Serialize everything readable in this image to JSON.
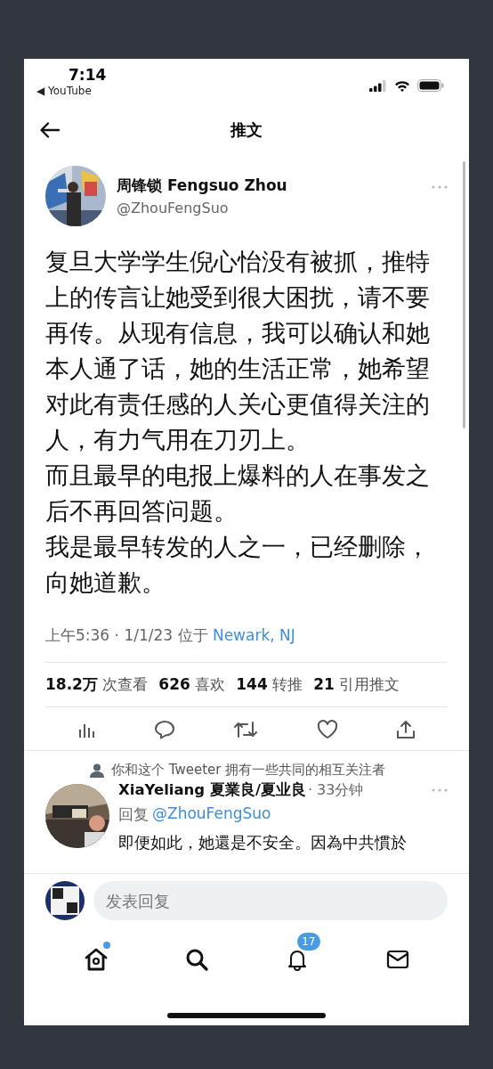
{
  "status_bar": {
    "time": "7:14",
    "back_app": "◀ YouTube"
  },
  "header": {
    "title": "推文"
  },
  "tweet": {
    "author_name": "周锋锁 Fengsuo Zhou",
    "handle": "@ZhouFengSuo",
    "paragraphs": [
      "复旦大学学生倪心怡没有被抓，推特上的传言让她受到很大困扰，请不要再传。从现有信息，我可以确认和她本人通了话，她的生活正常，她希望对此有责任感的人关心更值得关注的人，有力气用在刀刃上。",
      "而且最早的电报上爆料的人在事发之后不再回答问题。",
      "我是最早转发的人之一，已经删除，向她道歉。"
    ],
    "timestamp": "上午5:36 · 1/1/23 位于",
    "location": "Newark, NJ",
    "stats": [
      {
        "count": "18.2万",
        "label": "次查看"
      },
      {
        "count": "626",
        "label": "喜欢"
      },
      {
        "count": "144",
        "label": "转推"
      },
      {
        "count": "21",
        "label": "引用推文"
      }
    ]
  },
  "reply": {
    "context": "你和这个 Tweeter 拥有一些共同的相互关注者",
    "author_name": "XiaYeliang 夏業良/夏业良",
    "time": "· 33分钟",
    "replying_to_label": "回复",
    "replying_to": "@ZhouFengSuo",
    "text": "即便如此，她還是不安全。因為中共慣於"
  },
  "composer": {
    "placeholder": "发表回复"
  },
  "tab_bar": [
    {
      "kind": "home",
      "selected": true,
      "dot": true
    },
    {
      "kind": "search",
      "selected": false
    },
    {
      "kind": "notifications",
      "selected": false,
      "badge": "17"
    },
    {
      "kind": "messages",
      "selected": false
    }
  ]
}
